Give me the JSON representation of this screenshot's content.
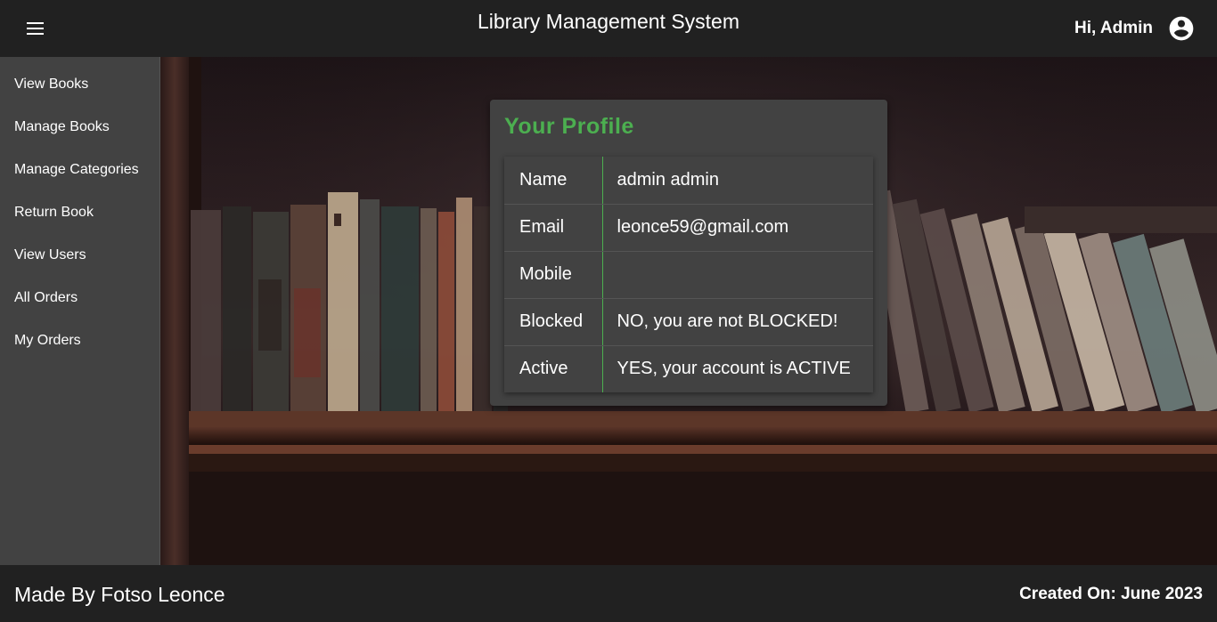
{
  "header": {
    "title": "Library Management System",
    "greeting": "Hi, Admin",
    "menu_icon": "menu-icon",
    "account_icon": "account-circle-icon"
  },
  "sidebar": {
    "items": [
      {
        "label": "View Books"
      },
      {
        "label": "Manage Books"
      },
      {
        "label": "Manage Categories"
      },
      {
        "label": "Return Book"
      },
      {
        "label": "View Users"
      },
      {
        "label": "All Orders"
      },
      {
        "label": "My Orders"
      }
    ]
  },
  "profile": {
    "title": "Your Profile",
    "rows": [
      {
        "label": "Name",
        "value": "admin admin"
      },
      {
        "label": "Email",
        "value": "leonce59@gmail.com"
      },
      {
        "label": "Mobile",
        "value": ""
      },
      {
        "label": "Blocked",
        "value": "NO, you are not BLOCKED!"
      },
      {
        "label": "Active",
        "value": "YES, your account is ACTIVE"
      }
    ]
  },
  "footer": {
    "made_by": "Made By Fotso Leonce",
    "created_on": "Created On: June 2023"
  },
  "colors": {
    "accent": "#4caf50",
    "appbar": "#212121",
    "sidebar": "#424242",
    "card": "#424242"
  }
}
